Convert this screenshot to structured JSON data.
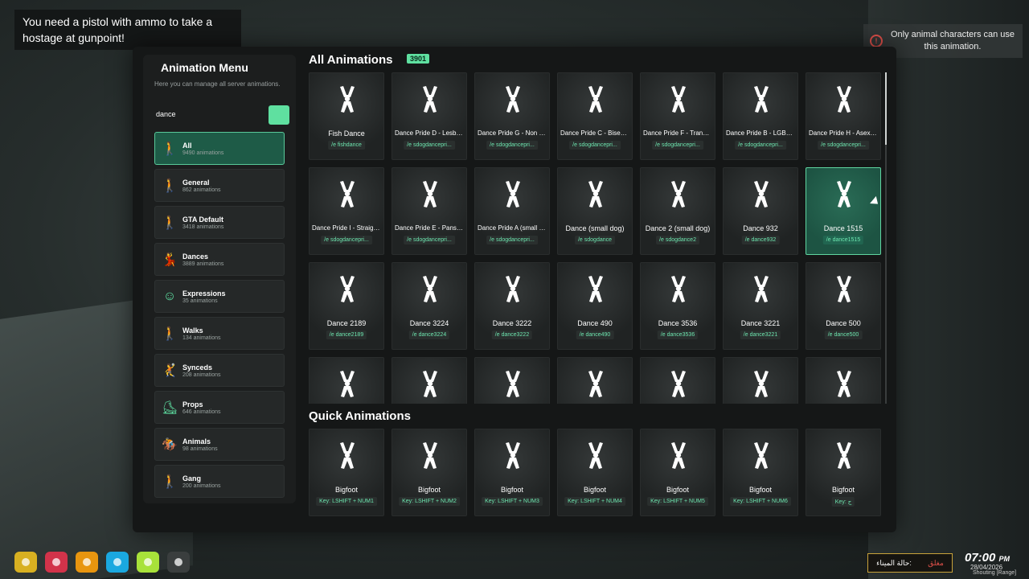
{
  "notification": "You need a pistol with ammo to take a hostage at gunpoint!",
  "alert": {
    "text": "Only animal characters can use this animation.",
    "icon": "exclamation-circle-icon",
    "color": "#e0504a"
  },
  "menu": {
    "title": "Animation Menu",
    "description": "Here you can manage all server animations.",
    "search_value": "dance",
    "accent": "#5fe0a0",
    "categories": [
      {
        "name": "All",
        "count": "9490 animations",
        "icon": "person-standing-icon",
        "active": true
      },
      {
        "name": "General",
        "count": "862 animations",
        "icon": "person-standing-icon"
      },
      {
        "name": "GTA Default",
        "count": "3418 animations",
        "icon": "person-standing-icon"
      },
      {
        "name": "Dances",
        "count": "3889 animations",
        "icon": "person-dancing-icon"
      },
      {
        "name": "Expressions",
        "count": "35 animations",
        "icon": "smiley-face-icon"
      },
      {
        "name": "Walks",
        "count": "134 animations",
        "icon": "person-walking-icon"
      },
      {
        "name": "Synceds",
        "count": "208 animations",
        "icon": "person-kicking-icon"
      },
      {
        "name": "Props",
        "count": "646 animations",
        "icon": "person-skating-icon"
      },
      {
        "name": "Animals",
        "count": "98 animations",
        "icon": "horse-rider-icon"
      },
      {
        "name": "Gang",
        "count": "200 animations",
        "icon": "person-standing-icon"
      }
    ]
  },
  "all_animations": {
    "title": "All Animations",
    "count": "3901",
    "items": [
      {
        "name": "Fish Dance",
        "cmd": "/e fishdance"
      },
      {
        "name": "Dance Pride D - Lesbian (...",
        "cmd": "/e sdogdancepri..."
      },
      {
        "name": "Dance Pride G - Non Binar...",
        "cmd": "/e sdogdancepri..."
      },
      {
        "name": "Dance Pride C - Bisexual ...",
        "cmd": "/e sdogdancepri..."
      },
      {
        "name": "Dance Pride F - Transgend...",
        "cmd": "/e sdogdancepri..."
      },
      {
        "name": "Dance Pride B - LGBTQIA (...",
        "cmd": "/e sdogdancepri..."
      },
      {
        "name": "Dance Pride H - Asexual (...",
        "cmd": "/e sdogdancepri..."
      },
      {
        "name": "Dance Pride I - Straight ...",
        "cmd": "/e sdogdancepri..."
      },
      {
        "name": "Dance Pride E - Pansexual...",
        "cmd": "/e sdogdancepri..."
      },
      {
        "name": "Dance Pride A (small dog)",
        "cmd": "/e sdogdancepri..."
      },
      {
        "name": "Dance (small dog)",
        "cmd": "/e sdogdance"
      },
      {
        "name": "Dance 2 (small dog)",
        "cmd": "/e sdogdance2"
      },
      {
        "name": "Dance 932",
        "cmd": "/e dance932"
      },
      {
        "name": "Dance 1515",
        "cmd": "/e dance1515",
        "active": true
      },
      {
        "name": "Dance 2189",
        "cmd": "/e dance2189"
      },
      {
        "name": "Dance 3224",
        "cmd": "/e dance3224"
      },
      {
        "name": "Dance 3222",
        "cmd": "/e dance3222"
      },
      {
        "name": "Dance 490",
        "cmd": "/e dance490"
      },
      {
        "name": "Dance 3536",
        "cmd": "/e dance3536"
      },
      {
        "name": "Dance 3221",
        "cmd": "/e dance3221"
      },
      {
        "name": "Dance 500",
        "cmd": "/e dance500"
      },
      {
        "name": "",
        "cmd": ""
      },
      {
        "name": "",
        "cmd": ""
      },
      {
        "name": "",
        "cmd": ""
      },
      {
        "name": "",
        "cmd": ""
      },
      {
        "name": "",
        "cmd": ""
      },
      {
        "name": "",
        "cmd": ""
      },
      {
        "name": "",
        "cmd": ""
      }
    ]
  },
  "quick_animations": {
    "title": "Quick Animations",
    "items": [
      {
        "name": "Bigfoot",
        "cmd": "Key: LSHIFT + NUM1"
      },
      {
        "name": "Bigfoot",
        "cmd": "Key: LSHIFT + NUM2"
      },
      {
        "name": "Bigfoot",
        "cmd": "Key: LSHIFT + NUM3"
      },
      {
        "name": "Bigfoot",
        "cmd": "Key: LSHIFT + NUM4"
      },
      {
        "name": "Bigfoot",
        "cmd": "Key: LSHIFT + NUM5"
      },
      {
        "name": "Bigfoot",
        "cmd": "Key: LSHIFT + NUM6"
      },
      {
        "name": "Bigfoot",
        "cmd": "Key: ج"
      }
    ]
  },
  "hud": {
    "indicators": [
      {
        "name": "hunger-indicator",
        "color": "#d8b021"
      },
      {
        "name": "health-indicator",
        "color": "#d2334a"
      },
      {
        "name": "food-indicator",
        "color": "#e8950f"
      },
      {
        "name": "water-indicator",
        "color": "#1aa8e0"
      },
      {
        "name": "stamina-indicator",
        "color": "#a8e23a"
      },
      {
        "name": "stress-indicator",
        "color": "#3a3e3e"
      }
    ]
  },
  "status": {
    "label": "حالة الميناء:",
    "value": "مغلق"
  },
  "clock": {
    "time": "07:00",
    "ampm": "PM",
    "date": "28/04/2026",
    "mode": "Shouting [Range]"
  }
}
